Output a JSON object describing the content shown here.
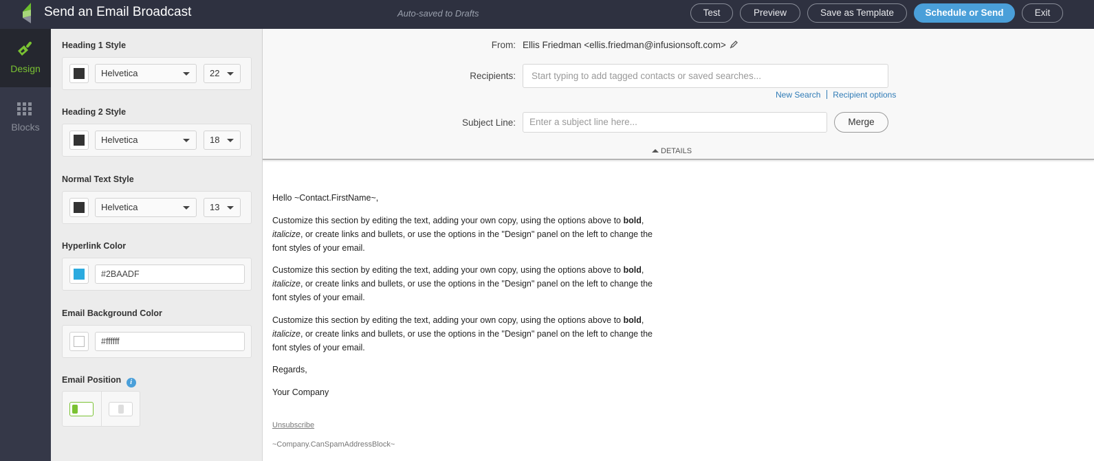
{
  "header": {
    "title": "Send an Email Broadcast",
    "autosave_status": "Auto-saved to Drafts",
    "buttons": {
      "test": "Test",
      "preview": "Preview",
      "save_template": "Save as Template",
      "schedule_send": "Schedule or Send",
      "exit": "Exit"
    }
  },
  "rail": {
    "items": [
      {
        "label": "Design",
        "icon": "paintbrush-icon",
        "active": true
      },
      {
        "label": "Blocks",
        "icon": "grid-icon",
        "active": false
      }
    ]
  },
  "design_panel": {
    "heading1": {
      "label": "Heading 1 Style",
      "color": "#333333",
      "font": "Helvetica",
      "size": "22"
    },
    "heading2": {
      "label": "Heading 2 Style",
      "color": "#333333",
      "font": "Helvetica",
      "size": "18"
    },
    "normal": {
      "label": "Normal Text Style",
      "color": "#333333",
      "font": "Helvetica",
      "size": "13"
    },
    "hyperlink": {
      "label": "Hyperlink Color",
      "value": "#2BAADF"
    },
    "background": {
      "label": "Email Background Color",
      "value": "#ffffff"
    },
    "position": {
      "label": "Email Position",
      "selected": "left",
      "options": [
        "left",
        "center"
      ]
    }
  },
  "details": {
    "from_label": "From:",
    "from_value": "Ellis Friedman <ellis.friedman@infusionsoft.com>",
    "recipients_label": "Recipients:",
    "recipients_placeholder": "Start typing to add tagged contacts or saved searches...",
    "new_search": "New Search",
    "recipient_options": "Recipient options",
    "subject_label": "Subject Line:",
    "subject_placeholder": "Enter a subject line here...",
    "merge": "Merge",
    "toggle": "DETAILS"
  },
  "email": {
    "greeting": "Hello ~Contact.FirstName~,",
    "paragraph": {
      "part1": "Customize this section by editing the text, adding your own copy, using the options above to ",
      "bold": "bold",
      "part2": ",",
      "italic": "italicize",
      "part3": ", or create links and bullets, or use the options in the \"Design\" panel on the left to change the font styles of your email."
    },
    "paragraph_count": 3,
    "regards": "Regards,",
    "company": "Your Company",
    "unsubscribe": "Unsubscribe",
    "address_block": "~Company.CanSpamAddressBlock~"
  },
  "colors": {
    "topbar": "#2e3140",
    "accent_green": "#7ac232",
    "primary_blue": "#4a9fd9",
    "link_blue": "#2f7bb6"
  }
}
